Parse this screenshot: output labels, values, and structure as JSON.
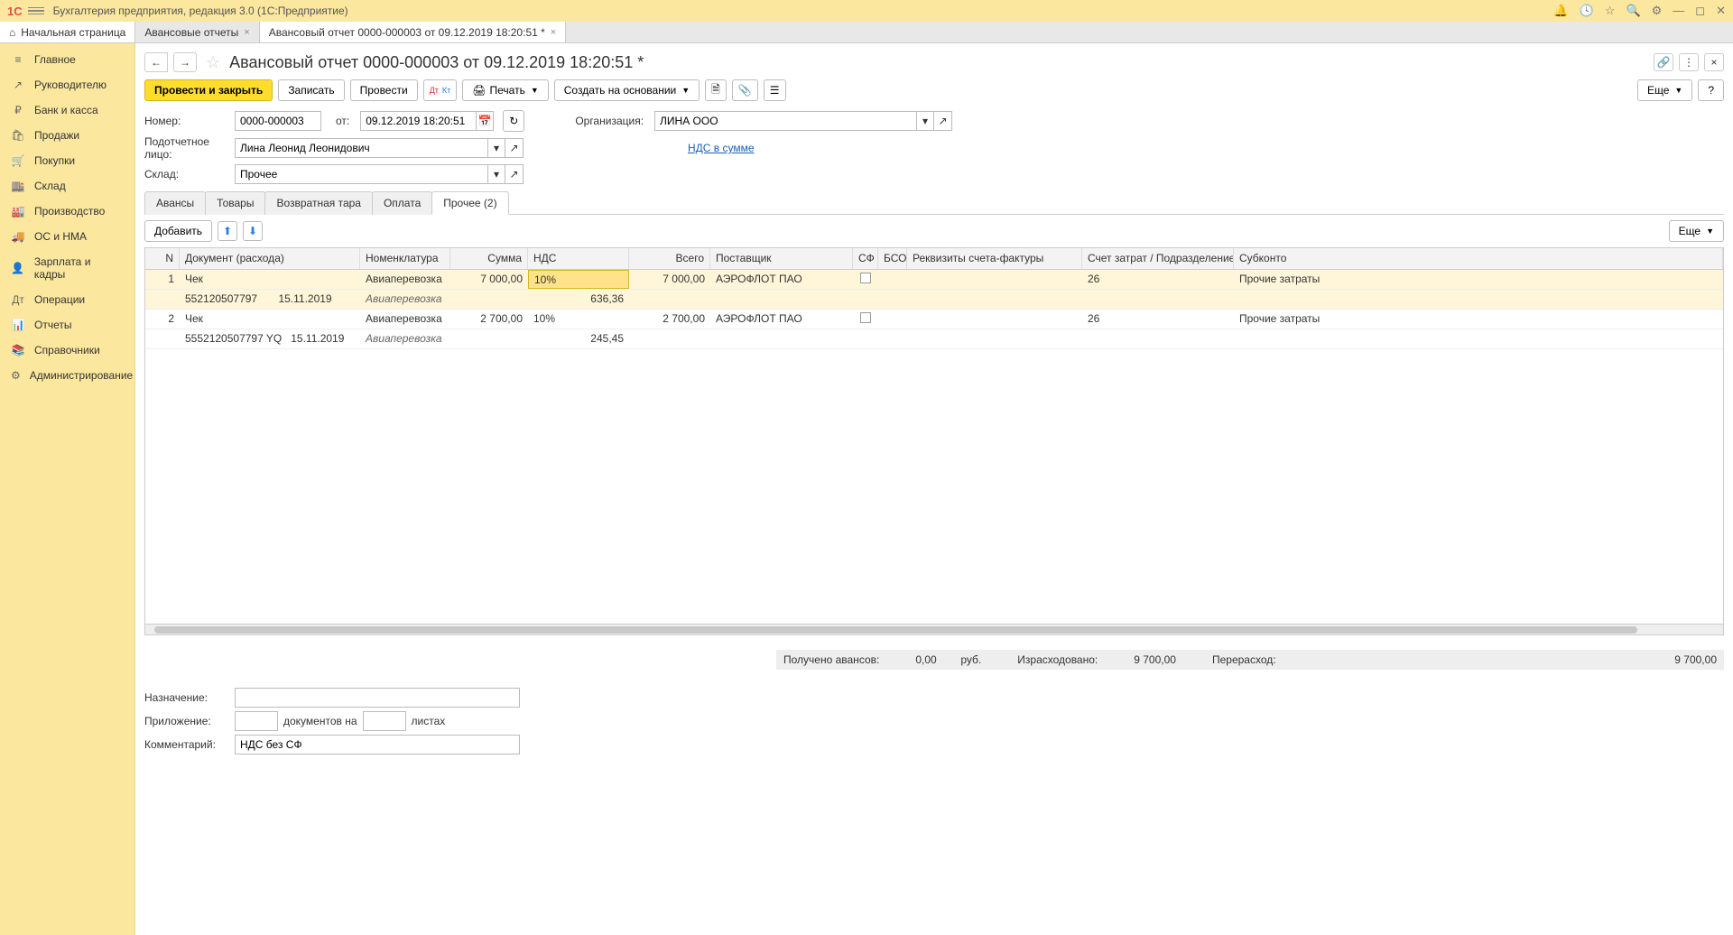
{
  "titlebar": {
    "app_name": "Бухгалтерия предприятия, редакция 3.0  (1С:Предприятие)",
    "logo": "1C"
  },
  "navtabs": {
    "home": "Начальная страница",
    "t1": "Авансовые отчеты",
    "t2": "Авансовый отчет 0000-000003 от 09.12.2019 18:20:51 *"
  },
  "sidebar": {
    "items": [
      {
        "icon": "≡",
        "label": "Главное"
      },
      {
        "icon": "↗",
        "label": "Руководителю"
      },
      {
        "icon": "₽",
        "label": "Банк и касса"
      },
      {
        "icon": "🛍",
        "label": "Продажи"
      },
      {
        "icon": "🛒",
        "label": "Покупки"
      },
      {
        "icon": "🏬",
        "label": "Склад"
      },
      {
        "icon": "🏭",
        "label": "Производство"
      },
      {
        "icon": "🚚",
        "label": "ОС и НМА"
      },
      {
        "icon": "👤",
        "label": "Зарплата и кадры"
      },
      {
        "icon": "Дт",
        "label": "Операции"
      },
      {
        "icon": "📊",
        "label": "Отчеты"
      },
      {
        "icon": "📚",
        "label": "Справочники"
      },
      {
        "icon": "⚙",
        "label": "Администрирование"
      }
    ]
  },
  "doc": {
    "title": "Авансовый отчет 0000-000003 от 09.12.2019 18:20:51 *"
  },
  "toolbar": {
    "post_close": "Провести и закрыть",
    "save": "Записать",
    "post": "Провести",
    "print": "Печать",
    "create_based": "Создать на основании",
    "more": "Еще",
    "help": "?"
  },
  "form": {
    "number_lbl": "Номер:",
    "number": "0000-000003",
    "from_lbl": "от:",
    "date": "09.12.2019 18:20:51",
    "org_lbl": "Организация:",
    "org": "ЛИНА ООО",
    "person_lbl": "Подотчетное лицо:",
    "person": "Лина Леонид Леонидович",
    "vat_link": "НДС в сумме",
    "warehouse_lbl": "Склад:",
    "warehouse": "Прочее"
  },
  "tabs": {
    "t1": "Авансы",
    "t2": "Товары",
    "t3": "Возвратная тара",
    "t4": "Оплата",
    "t5": "Прочее (2)"
  },
  "tab_toolbar": {
    "add": "Добавить",
    "more": "Еще"
  },
  "grid": {
    "headers": {
      "n": "N",
      "doc": "Документ (расхода)",
      "nom": "Номенклатура",
      "sum": "Сумма",
      "nds": "НДС",
      "total": "Всего",
      "sup": "Поставщик",
      "sf": "СФ",
      "bso": "БСО",
      "req": "Реквизиты счета-фактуры",
      "acc": "Счет затрат / Подразделение",
      "sub": "Субконто"
    },
    "rows": [
      {
        "n": "1",
        "doc1": "Чек",
        "nom": "Авиаперевозка",
        "sum": "7 000,00",
        "nds": "10%",
        "total": "7 000,00",
        "sup": "АЭРОФЛОТ ПАО",
        "acc": "26",
        "sub": "Прочие затраты",
        "doc2": "552120507797",
        "doc2date": "15.11.2019",
        "nom2": "Авиаперевозка",
        "nds2": "636,36"
      },
      {
        "n": "2",
        "doc1": "Чек",
        "nom": "Авиаперевозка",
        "sum": "2 700,00",
        "nds": "10%",
        "total": "2 700,00",
        "sup": "АЭРОФЛОТ ПАО",
        "acc": "26",
        "sub": "Прочие затраты",
        "doc2": "5552120507797 YQ",
        "doc2date": "15.11.2019",
        "nom2": "Авиаперевозка",
        "nds2": "245,45"
      }
    ]
  },
  "totals": {
    "adv_lbl": "Получено авансов:",
    "adv_val": "0,00",
    "adv_cur": "руб.",
    "spent_lbl": "Израсходовано:",
    "spent_val": "9 700,00",
    "over_lbl": "Перерасход:",
    "over_val": "9 700,00"
  },
  "bottom": {
    "purpose_lbl": "Назначение:",
    "attach_lbl": "Приложение:",
    "docs_on": "документов на",
    "sheets": "листах",
    "comment_lbl": "Комментарий:",
    "comment": "НДС без СФ"
  }
}
